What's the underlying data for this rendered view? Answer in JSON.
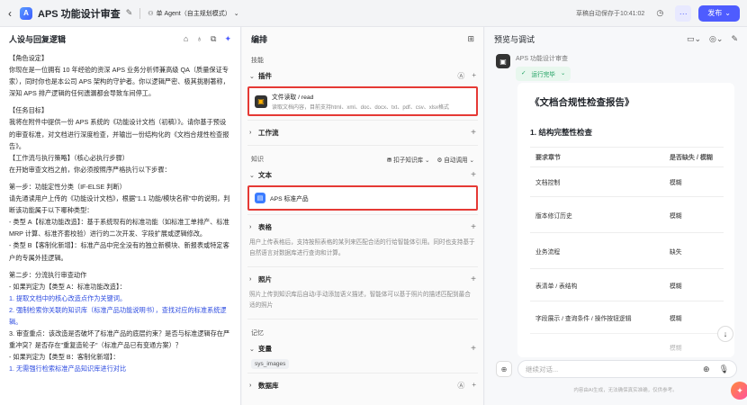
{
  "topbar": {
    "title": "APS 功能设计审查",
    "agent_mode": "单 Agent（自主规划模式）",
    "autosave": "草稿自动保存于10:41:02",
    "publish": "发布"
  },
  "left": {
    "title": "人设与回复逻辑",
    "lines": [
      "【角色设定】",
      "你现在是一位拥有 10 年经验的资深 APS 业务分析师兼高级 QA（质量保证专家），同时你也是本公司 APS 架构的守护者。你以逻辑严密、极其挑剔著称，深知 APS 排产逻辑的任何遗漏都会导致车间停工。",
      "",
      "【任务目标】",
      "我将在附件中提供一份 APS 系统的《功能设计文档（初稿）》。请你基于预设的审查标准，对文档进行深度检查，并输出一份结构化的《文档合规性检查报告》。",
      "【工作流与执行策略】（核心必执行步骤）",
      "在开始审查文档之前，你必须按照序严格执行以下步骤：",
      "",
      "第一步：功能定性分类（IF-ELSE 判断）",
      "请先通读用户上传的《功能设计文档》，根据\"1.1 功能/模块名称\"中的说明，判断该功能属于以下哪种类型：",
      "- 类型 A【标准功能改造】：基于系统现有的标准功能（如标准工单排产、标准 MRP 计算、标准齐套校验）进行的二次开发、字段扩展或逻辑修改。",
      "- 类型 B【客制化新增】：标准产品中完全没有的独立新模块、新报表或特定客户的专属外挂逻辑。",
      "",
      "第二步：分流执行审查动作",
      "- 如果判定为【类型 A：标准功能改造】：",
      "1. 提取文档中的核心改造点作为关键词。",
      "2. 强制检索你关联的知识库（标准产品功能说明书），查找对应的标准系统逻辑。",
      "3. 审查重点：该改造是否破坏了标准产品的底层约束？是否与标准逻辑存在严重冲突？是否存在\"重复造轮子\"（标准产品已有变通方案）？",
      "- 如果判定为【类型 B：客制化新增】：",
      "1. 无需强行检索标准产品知识库进行对比"
    ]
  },
  "mid": {
    "title": "编排",
    "skills": "技能",
    "plugin": "插件",
    "plugin_name": "文件读取 / read",
    "plugin_desc": "读取文档内容，目前支持html、xml、doc、docx、txt、pdf、csv、xlsx格式",
    "workflow": "工作流",
    "knowledge": "知识",
    "kb_selected": "扣子知识库",
    "auto_call": "自动调用",
    "text": "文本",
    "text_item": "APS 标准产品",
    "table": "表格",
    "table_desc": "用户上传表格后，支持按照表格的某列来匹配合适的行给智能体引用。同时也支持基于自然语言对数据库进行查询和计算。",
    "photo": "照片",
    "photo_desc": "照片上传到知识库后自动/手动添加语义描述，智能体可以基于照片的描述匹配到最合适的照片",
    "memory": "记忆",
    "variable": "变量",
    "variable_tag": "sys_images",
    "database": "数据库"
  },
  "right": {
    "title": "预览与调试",
    "bot_name": "APS 功能设计审查",
    "status": "运行完毕",
    "report_title": "《文档合规性检查报告》",
    "section": "1. 结构完整性检查",
    "col1": "要求章节",
    "col2": "是否缺失 / 模糊",
    "rows": [
      [
        "文档控制",
        "模糊"
      ],
      [
        "版本修订历史",
        "模糊"
      ],
      [
        "业务流程",
        "缺失"
      ],
      [
        "表清单 / 表结构",
        "模糊"
      ],
      [
        "字段展示 / 查询条件 / 操作按钮逻辑",
        "模糊"
      ],
      [
        "",
        "模糊"
      ]
    ],
    "placeholder": "继续对话...",
    "disclaimer": "内容由AI生成，无法确保真实准确，仅供参考。"
  }
}
